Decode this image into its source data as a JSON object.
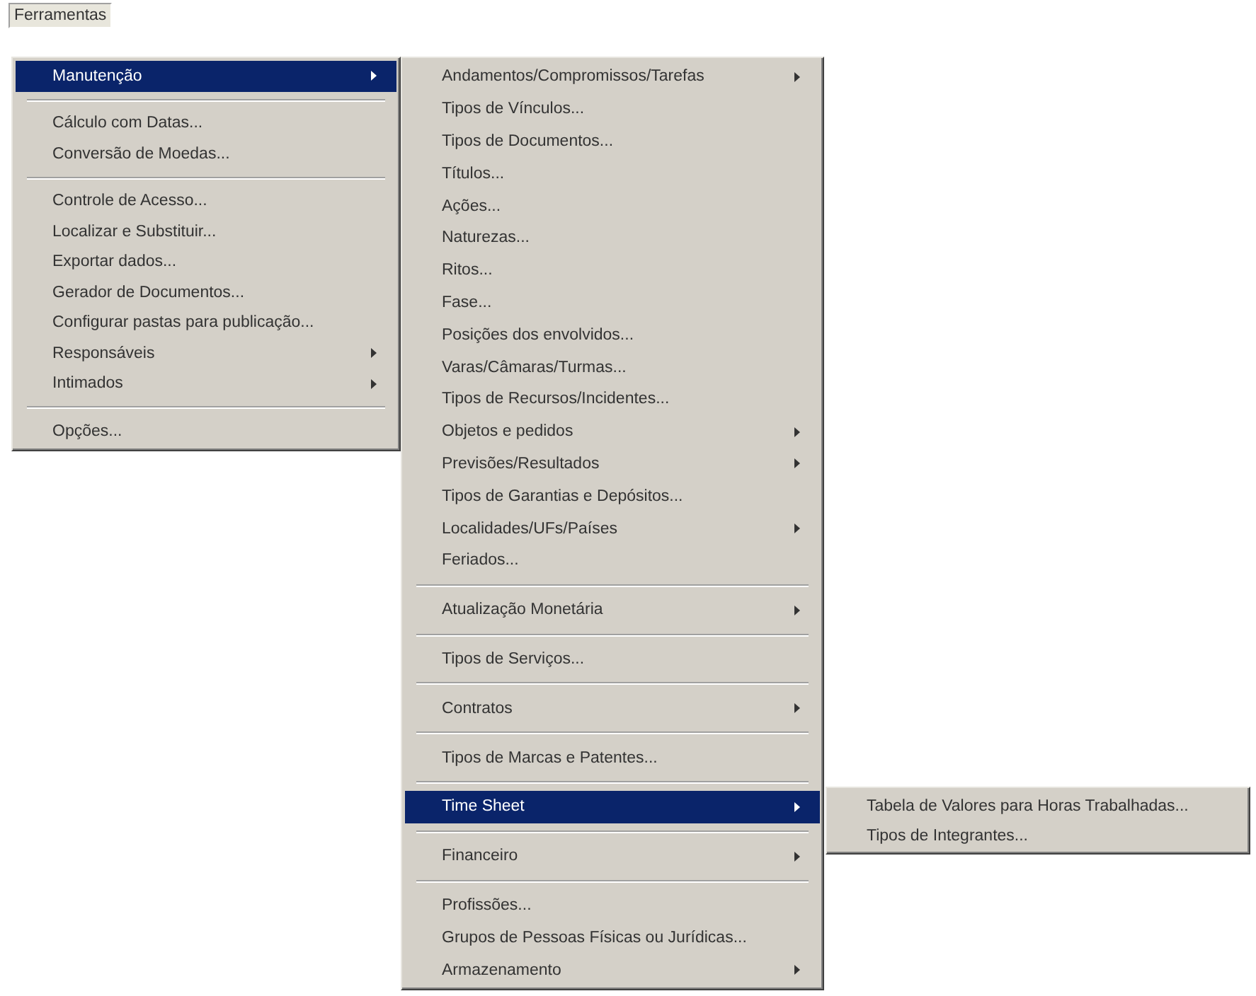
{
  "menubar": {
    "title": "Ferramentas"
  },
  "menus": [
    {
      "items": [
        {
          "kind": "item",
          "label": "Manutenção",
          "submenu": true,
          "selected": true
        },
        {
          "kind": "separator"
        },
        {
          "kind": "item",
          "label": "Cálculo com Datas...",
          "submenu": false,
          "selected": false
        },
        {
          "kind": "item",
          "label": "Conversão de Moedas...",
          "submenu": false,
          "selected": false
        },
        {
          "kind": "separator"
        },
        {
          "kind": "item",
          "label": "Controle de Acesso...",
          "submenu": false,
          "selected": false
        },
        {
          "kind": "item",
          "label": "Localizar e Substituir...",
          "submenu": false,
          "selected": false
        },
        {
          "kind": "item",
          "label": "Exportar dados...",
          "submenu": false,
          "selected": false
        },
        {
          "kind": "item",
          "label": "Gerador de Documentos...",
          "submenu": false,
          "selected": false
        },
        {
          "kind": "item",
          "label": "Configurar pastas para publicação...",
          "submenu": false,
          "selected": false
        },
        {
          "kind": "item",
          "label": "Responsáveis",
          "submenu": true,
          "selected": false
        },
        {
          "kind": "item",
          "label": "Intimados",
          "submenu": true,
          "selected": false
        },
        {
          "kind": "separator"
        },
        {
          "kind": "item",
          "label": "Opções...",
          "submenu": false,
          "selected": false
        }
      ]
    },
    {
      "items": [
        {
          "kind": "item",
          "label": "Andamentos/Compromissos/Tarefas",
          "submenu": true,
          "selected": false
        },
        {
          "kind": "item",
          "label": "Tipos de Vínculos...",
          "submenu": false,
          "selected": false
        },
        {
          "kind": "item",
          "label": "Tipos de Documentos...",
          "submenu": false,
          "selected": false
        },
        {
          "kind": "item",
          "label": "Títulos...",
          "submenu": false,
          "selected": false
        },
        {
          "kind": "item",
          "label": "Ações...",
          "submenu": false,
          "selected": false
        },
        {
          "kind": "item",
          "label": "Naturezas...",
          "submenu": false,
          "selected": false
        },
        {
          "kind": "item",
          "label": "Ritos...",
          "submenu": false,
          "selected": false
        },
        {
          "kind": "item",
          "label": "Fase...",
          "submenu": false,
          "selected": false
        },
        {
          "kind": "item",
          "label": "Posições dos envolvidos...",
          "submenu": false,
          "selected": false
        },
        {
          "kind": "item",
          "label": "Varas/Câmaras/Turmas...",
          "submenu": false,
          "selected": false
        },
        {
          "kind": "item",
          "label": "Tipos de Recursos/Incidentes...",
          "submenu": false,
          "selected": false
        },
        {
          "kind": "item",
          "label": "Objetos e pedidos",
          "submenu": true,
          "selected": false
        },
        {
          "kind": "item",
          "label": "Previsões/Resultados",
          "submenu": true,
          "selected": false
        },
        {
          "kind": "item",
          "label": "Tipos de Garantias e Depósitos...",
          "submenu": false,
          "selected": false
        },
        {
          "kind": "item",
          "label": "Localidades/UFs/Países",
          "submenu": true,
          "selected": false
        },
        {
          "kind": "item",
          "label": "Feriados...",
          "submenu": false,
          "selected": false
        },
        {
          "kind": "separator"
        },
        {
          "kind": "item",
          "label": "Atualização Monetária",
          "submenu": true,
          "selected": false
        },
        {
          "kind": "separator"
        },
        {
          "kind": "item",
          "label": "Tipos de Serviços...",
          "submenu": false,
          "selected": false
        },
        {
          "kind": "separator"
        },
        {
          "kind": "item",
          "label": "Contratos",
          "submenu": true,
          "selected": false
        },
        {
          "kind": "separator"
        },
        {
          "kind": "item",
          "label": "Tipos de Marcas e Patentes...",
          "submenu": false,
          "selected": false
        },
        {
          "kind": "separator"
        },
        {
          "kind": "item",
          "label": "Time Sheet",
          "submenu": true,
          "selected": true
        },
        {
          "kind": "separator"
        },
        {
          "kind": "item",
          "label": "Financeiro",
          "submenu": true,
          "selected": false
        },
        {
          "kind": "separator"
        },
        {
          "kind": "item",
          "label": "Profissões...",
          "submenu": false,
          "selected": false
        },
        {
          "kind": "item",
          "label": "Grupos de Pessoas Físicas ou Jurídicas...",
          "submenu": false,
          "selected": false
        },
        {
          "kind": "item",
          "label": "Armazenamento",
          "submenu": true,
          "selected": false
        }
      ]
    },
    {
      "items": [
        {
          "kind": "item",
          "label": "Tabela de Valores para Horas Trabalhadas...",
          "submenu": false,
          "selected": false
        },
        {
          "kind": "item",
          "label": "Tipos de Integrantes...",
          "submenu": false,
          "selected": false
        }
      ]
    }
  ]
}
